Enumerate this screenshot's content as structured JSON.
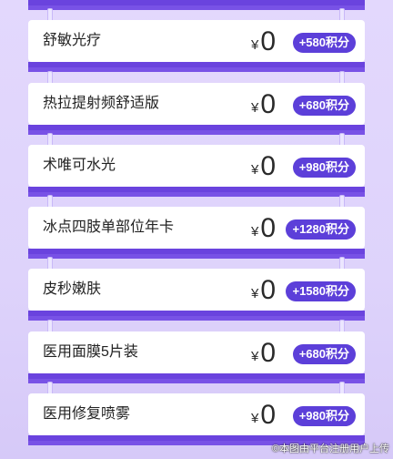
{
  "currency": "¥",
  "items": [
    {
      "name": "",
      "price": "0",
      "points": ""
    },
    {
      "name": "舒敏光疗",
      "price": "0",
      "points": "+580积分"
    },
    {
      "name": "热拉提射频舒适版",
      "price": "0",
      "points": "+680积分"
    },
    {
      "name": "术唯可水光",
      "price": "0",
      "points": "+980积分"
    },
    {
      "name": "冰点四肢单部位年卡",
      "price": "0",
      "points": "+1280积分"
    },
    {
      "name": "皮秒嫩肤",
      "price": "0",
      "points": "+1580积分"
    },
    {
      "name": "医用面膜5片装",
      "price": "0",
      "points": "+680积分"
    },
    {
      "name": "医用修复喷雾",
      "price": "0",
      "points": "+980积分"
    }
  ],
  "watermark": "©本图由平台注册用户上传",
  "colors": {
    "band": "#7852e6",
    "badge": "#5c3fd9",
    "background": "#e3d8fd"
  }
}
